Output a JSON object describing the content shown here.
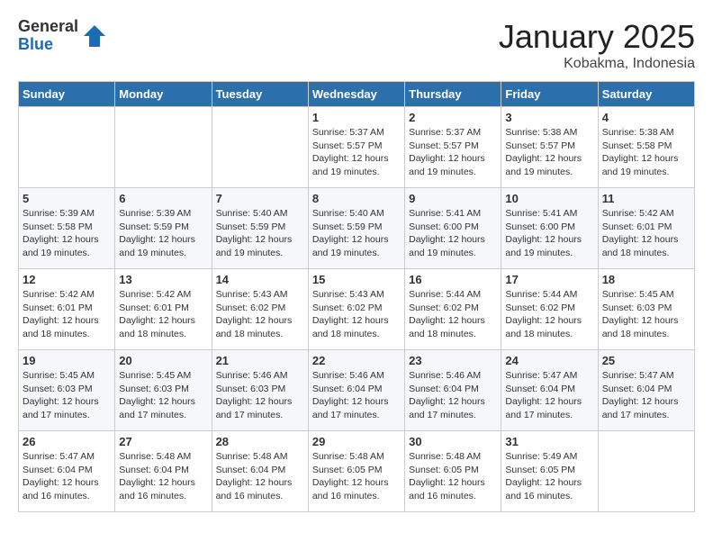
{
  "logo": {
    "general": "General",
    "blue": "Blue"
  },
  "title": "January 2025",
  "location": "Kobakma, Indonesia",
  "days_header": [
    "Sunday",
    "Monday",
    "Tuesday",
    "Wednesday",
    "Thursday",
    "Friday",
    "Saturday"
  ],
  "weeks": [
    [
      {
        "day": "",
        "info": ""
      },
      {
        "day": "",
        "info": ""
      },
      {
        "day": "",
        "info": ""
      },
      {
        "day": "1",
        "info": "Sunrise: 5:37 AM\nSunset: 5:57 PM\nDaylight: 12 hours\nand 19 minutes."
      },
      {
        "day": "2",
        "info": "Sunrise: 5:37 AM\nSunset: 5:57 PM\nDaylight: 12 hours\nand 19 minutes."
      },
      {
        "day": "3",
        "info": "Sunrise: 5:38 AM\nSunset: 5:57 PM\nDaylight: 12 hours\nand 19 minutes."
      },
      {
        "day": "4",
        "info": "Sunrise: 5:38 AM\nSunset: 5:58 PM\nDaylight: 12 hours\nand 19 minutes."
      }
    ],
    [
      {
        "day": "5",
        "info": "Sunrise: 5:39 AM\nSunset: 5:58 PM\nDaylight: 12 hours\nand 19 minutes."
      },
      {
        "day": "6",
        "info": "Sunrise: 5:39 AM\nSunset: 5:59 PM\nDaylight: 12 hours\nand 19 minutes."
      },
      {
        "day": "7",
        "info": "Sunrise: 5:40 AM\nSunset: 5:59 PM\nDaylight: 12 hours\nand 19 minutes."
      },
      {
        "day": "8",
        "info": "Sunrise: 5:40 AM\nSunset: 5:59 PM\nDaylight: 12 hours\nand 19 minutes."
      },
      {
        "day": "9",
        "info": "Sunrise: 5:41 AM\nSunset: 6:00 PM\nDaylight: 12 hours\nand 19 minutes."
      },
      {
        "day": "10",
        "info": "Sunrise: 5:41 AM\nSunset: 6:00 PM\nDaylight: 12 hours\nand 19 minutes."
      },
      {
        "day": "11",
        "info": "Sunrise: 5:42 AM\nSunset: 6:01 PM\nDaylight: 12 hours\nand 18 minutes."
      }
    ],
    [
      {
        "day": "12",
        "info": "Sunrise: 5:42 AM\nSunset: 6:01 PM\nDaylight: 12 hours\nand 18 minutes."
      },
      {
        "day": "13",
        "info": "Sunrise: 5:42 AM\nSunset: 6:01 PM\nDaylight: 12 hours\nand 18 minutes."
      },
      {
        "day": "14",
        "info": "Sunrise: 5:43 AM\nSunset: 6:02 PM\nDaylight: 12 hours\nand 18 minutes."
      },
      {
        "day": "15",
        "info": "Sunrise: 5:43 AM\nSunset: 6:02 PM\nDaylight: 12 hours\nand 18 minutes."
      },
      {
        "day": "16",
        "info": "Sunrise: 5:44 AM\nSunset: 6:02 PM\nDaylight: 12 hours\nand 18 minutes."
      },
      {
        "day": "17",
        "info": "Sunrise: 5:44 AM\nSunset: 6:02 PM\nDaylight: 12 hours\nand 18 minutes."
      },
      {
        "day": "18",
        "info": "Sunrise: 5:45 AM\nSunset: 6:03 PM\nDaylight: 12 hours\nand 18 minutes."
      }
    ],
    [
      {
        "day": "19",
        "info": "Sunrise: 5:45 AM\nSunset: 6:03 PM\nDaylight: 12 hours\nand 17 minutes."
      },
      {
        "day": "20",
        "info": "Sunrise: 5:45 AM\nSunset: 6:03 PM\nDaylight: 12 hours\nand 17 minutes."
      },
      {
        "day": "21",
        "info": "Sunrise: 5:46 AM\nSunset: 6:03 PM\nDaylight: 12 hours\nand 17 minutes."
      },
      {
        "day": "22",
        "info": "Sunrise: 5:46 AM\nSunset: 6:04 PM\nDaylight: 12 hours\nand 17 minutes."
      },
      {
        "day": "23",
        "info": "Sunrise: 5:46 AM\nSunset: 6:04 PM\nDaylight: 12 hours\nand 17 minutes."
      },
      {
        "day": "24",
        "info": "Sunrise: 5:47 AM\nSunset: 6:04 PM\nDaylight: 12 hours\nand 17 minutes."
      },
      {
        "day": "25",
        "info": "Sunrise: 5:47 AM\nSunset: 6:04 PM\nDaylight: 12 hours\nand 17 minutes."
      }
    ],
    [
      {
        "day": "26",
        "info": "Sunrise: 5:47 AM\nSunset: 6:04 PM\nDaylight: 12 hours\nand 16 minutes."
      },
      {
        "day": "27",
        "info": "Sunrise: 5:48 AM\nSunset: 6:04 PM\nDaylight: 12 hours\nand 16 minutes."
      },
      {
        "day": "28",
        "info": "Sunrise: 5:48 AM\nSunset: 6:04 PM\nDaylight: 12 hours\nand 16 minutes."
      },
      {
        "day": "29",
        "info": "Sunrise: 5:48 AM\nSunset: 6:05 PM\nDaylight: 12 hours\nand 16 minutes."
      },
      {
        "day": "30",
        "info": "Sunrise: 5:48 AM\nSunset: 6:05 PM\nDaylight: 12 hours\nand 16 minutes."
      },
      {
        "day": "31",
        "info": "Sunrise: 5:49 AM\nSunset: 6:05 PM\nDaylight: 12 hours\nand 16 minutes."
      },
      {
        "day": "",
        "info": ""
      }
    ]
  ]
}
